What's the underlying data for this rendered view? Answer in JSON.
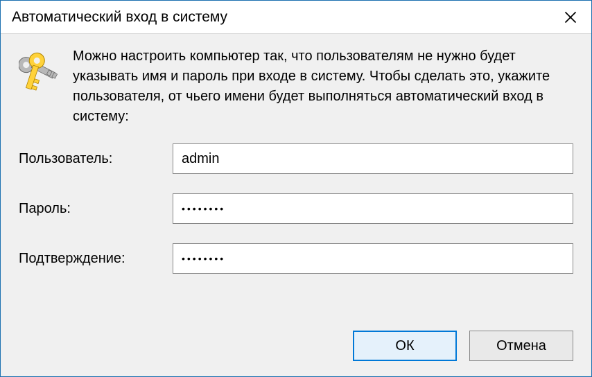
{
  "window": {
    "title": "Автоматический вход в систему"
  },
  "intro": {
    "text": "Можно настроить компьютер так, что пользователям не нужно будет указывать имя и пароль при входе в систему. Чтобы сделать это, укажите пользователя, от чьего имени будет выполняться автоматический вход в систему:"
  },
  "form": {
    "username_label": "Пользователь:",
    "username_value": "admin",
    "password_label": "Пароль:",
    "password_value": "••••••••",
    "confirm_label": "Подтверждение:",
    "confirm_value": "••••••••"
  },
  "buttons": {
    "ok": "ОК",
    "cancel": "Отмена"
  }
}
